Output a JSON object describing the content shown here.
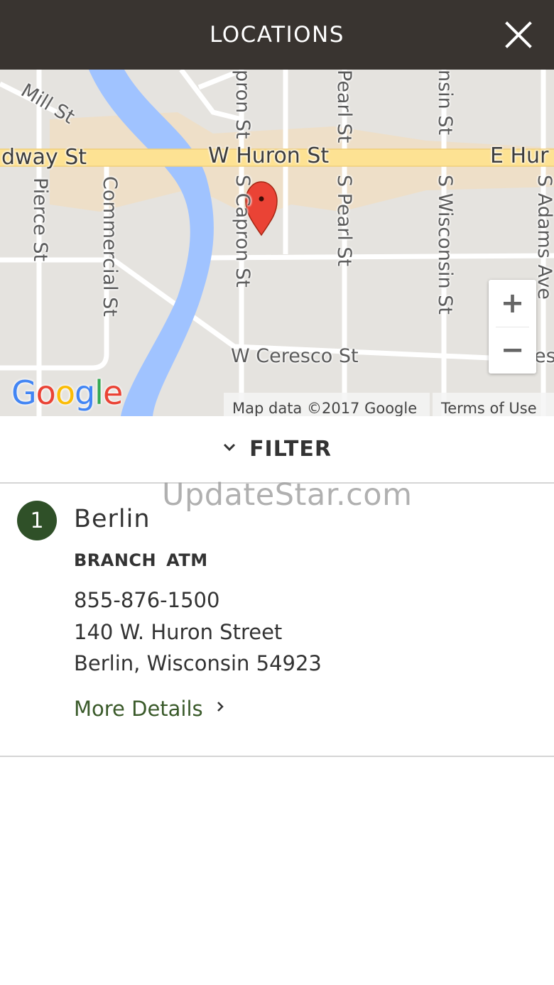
{
  "header": {
    "title": "LOCATIONS",
    "close_icon": "close-icon"
  },
  "map": {
    "streets": {
      "broadway": "dway St",
      "w_huron": "W Huron St",
      "e_huron": "E Hur",
      "mill": "Mill St",
      "pierce": "Pierce St",
      "commercial": "Commercial St",
      "capron_top": "pron St",
      "capron": "S Capron St",
      "pearl_top": "Pearl St",
      "pearl": "S Pearl St",
      "wisconsin_top": "nsin St",
      "wisconsin": "S Wisconsin St",
      "adams": "S Adams Ave",
      "ceresco": "W Ceresco St",
      "ceresco_e": "es"
    },
    "zoom_in_label": "+",
    "zoom_out_label": "−",
    "attribution": "Map data ©2017 Google",
    "terms": "Terms of Use",
    "logo": "Google",
    "marker_icon": "map-marker-icon",
    "colors": {
      "land": "#e5e3df",
      "road": "#ffffff",
      "major_road": "#fde293",
      "water": "#a0c3ff",
      "built": "#eedec5",
      "marker": "#ea4335"
    }
  },
  "filter": {
    "label": "FILTER",
    "icon": "chevron-down-icon"
  },
  "watermark": "UpdateStar.com",
  "location": {
    "number": "1",
    "name": "Berlin",
    "types": [
      "BRANCH",
      "ATM"
    ],
    "phone": "855-876-1500",
    "address_line1": "140 W. Huron Street",
    "address_line2": "Berlin, Wisconsin 54923",
    "more_details": "More Details",
    "colors": {
      "badge": "#2f5028",
      "link": "#3a5a2a"
    }
  },
  "colors": {
    "header_bg": "#393430",
    "header_text": "#ffffff",
    "divider": "#d5d5d5"
  }
}
